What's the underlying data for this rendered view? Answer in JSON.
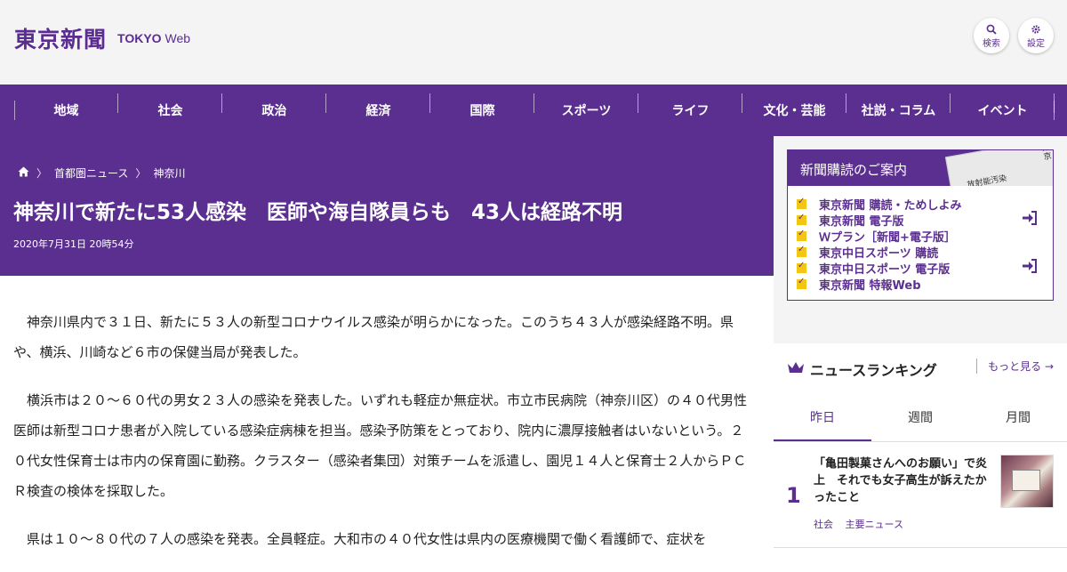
{
  "header": {
    "logo_jp": "東京新聞",
    "logo_en_bold": "TOKYO",
    "logo_en_light": "Web",
    "search_icon": "search-icon",
    "search_label": "検索",
    "settings_icon": "gear-icon",
    "settings_label": "設定"
  },
  "nav": {
    "items": [
      "地域",
      "社会",
      "政治",
      "経済",
      "国際",
      "スポーツ",
      "ライフ",
      "文化・芸能",
      "社説・コラム",
      "イベント"
    ]
  },
  "article": {
    "breadcrumb": {
      "home_icon": "home-icon",
      "items": [
        "首都圏ニュース",
        "神奈川"
      ]
    },
    "title": "神奈川で新たに53人感染　医師や海自隊員らも　43人は経路不明",
    "date": "2020年7月31日 20時54分",
    "paragraphs": [
      "神奈川県内で３１日、新たに５３人の新型コロナウイルス感染が明らかになった。このうち４３人が感染経路不明。県や、横浜、川崎など６市の保健当局が発表した。",
      "横浜市は２０～６０代の男女２３人の感染を発表した。いずれも軽症か無症状。市立市民病院（神奈川区）の４０代男性医師は新型コロナ患者が入院している感染症病棟を担当。感染予防策をとっており、院内に濃厚接触者はいないという。２０代女性保育士は市内の保育園に勤務。クラスター（感染者集団）対策チームを派遣し、園児１４人と保育士２人からＰＣＲ検査の検体を採取した。",
      "県は１０～８０代の７人の感染を発表。全員軽症。大和市の４０代女性は県内の医療機関で働く看護師で、症状を"
    ]
  },
  "sidebar": {
    "subscription": {
      "title": "新聞購読のご案内",
      "items": [
        {
          "label": "東京新聞 購読・ためしよみ",
          "signin": false
        },
        {
          "label": "東京新聞 電子版",
          "signin": true
        },
        {
          "label": "Ｗプラン［新聞+電子版］",
          "signin": false
        },
        {
          "label": "東京中日スポーツ 購読",
          "signin": false
        },
        {
          "label": "東京中日スポーツ 電子版",
          "signin": true
        },
        {
          "label": "東京新聞 特報Web",
          "signin": false
        }
      ]
    },
    "ranking": {
      "title": "ニュースランキング",
      "more": "もっと見る",
      "tabs": [
        "昨日",
        "週間",
        "月間"
      ],
      "active_tab": "昨日",
      "items": [
        {
          "rank": "1",
          "text": "「亀田製菓さんへのお願い」で炎上　それでも女子高生が訴えたかったこと",
          "tags": [
            "社会",
            "主要ニュース"
          ]
        }
      ]
    }
  },
  "colors": {
    "brand_purple": "#5b2f8f",
    "check_yellow": "#f3c613"
  }
}
